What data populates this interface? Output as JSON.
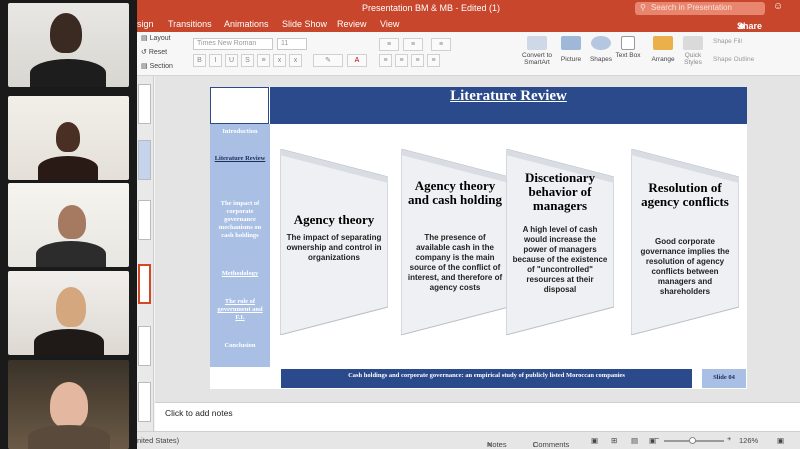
{
  "window": {
    "title": "Presentation BM & MB - Edited (1)",
    "search_placeholder": "Search in Presentation",
    "share_label": "Share"
  },
  "menu": {
    "items": [
      "sign",
      "Transitions",
      "Animations",
      "Slide Show",
      "Review",
      "View"
    ]
  },
  "ribbon": {
    "layout": "Layout",
    "reset": "Reset",
    "section": "Section",
    "font_name": "Times New Roman",
    "font_size": "11",
    "convert_smartart": "Convert to SmartArt",
    "picture": "Picture",
    "shapes": "Shapes",
    "text_box": "Text Box",
    "arrange": "Arrange",
    "quick_styles": "Quick Styles",
    "shape_fill": "Shape Fill",
    "shape_outline": "Shape Outline"
  },
  "slide": {
    "title": "Literature Review",
    "sidebar": [
      "Introduction",
      "Literature Review",
      "The impact of corporate governance mechanisms on cash holdings",
      "Methodology",
      "The role of government and F.I.",
      "Conclusion"
    ],
    "panels": [
      {
        "title": "Agency theory",
        "body": "The impact of separating ownership and control in organizations"
      },
      {
        "title": "Agency theory and cash holding",
        "body": "The presence of available cash in the company is the main source of the conflict of interest, and therefore of agency costs"
      },
      {
        "title": "Discetionary behavior of managers",
        "body": "A high level of cash would increase the power of managers because of the existence of \"uncontrolled\" resources at their disposal"
      },
      {
        "title": "Resolution of agency conflicts",
        "body": "Good corporate governance implies the resolution of agency conflicts between managers and shareholders"
      }
    ],
    "footer": "Cash holdings and corporate governance: an empirical study of publicly listed Moroccan companies",
    "slide_number": "Slide 04"
  },
  "notes_placeholder": "Click to add notes",
  "status": {
    "language": "nited States)",
    "notes": "Notes",
    "comments": "Comments",
    "zoom": "126%"
  },
  "colors": {
    "accent": "#c8462c",
    "slide_blue": "#2a4a8c",
    "sidebar_blue": "#a9bfe4"
  }
}
